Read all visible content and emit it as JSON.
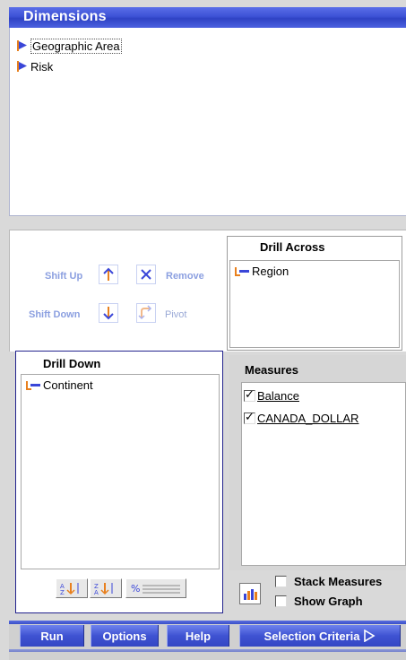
{
  "dimensions": {
    "title": "Dimensions",
    "items": [
      {
        "label": "Geographic Area",
        "icon": "dimension-flag-icon"
      },
      {
        "label": "Risk",
        "icon": "dimension-flag-icon"
      }
    ]
  },
  "toolbar": {
    "shift_up": "Shift Up",
    "remove": "Remove",
    "shift_down": "Shift Down",
    "pivot": "Pivot"
  },
  "drill_across": {
    "title": "Drill Across",
    "items": [
      {
        "label": "Region",
        "icon": "level-icon"
      }
    ]
  },
  "drill_down": {
    "title": "Drill Down",
    "items": [
      {
        "label": "Continent",
        "icon": "level-icon"
      }
    ],
    "sort_buttons": [
      "sort-ascending-icon",
      "sort-descending-icon",
      "percent-icon"
    ]
  },
  "measures": {
    "title": "Measures",
    "items": [
      {
        "label": "Balance",
        "checked": true
      },
      {
        "label": "CANADA_DOLLAR",
        "checked": true
      }
    ],
    "stack_measures": {
      "label": "Stack Measures",
      "checked": false
    },
    "show_graph": {
      "label": "Show Graph",
      "checked": false
    }
  },
  "bottom_bar": {
    "run": "Run",
    "options": "Options",
    "help": "Help",
    "selection_criteria": "Selection Criteria"
  },
  "colors": {
    "accent": "#3d52d6",
    "icon_orange": "#e8801e",
    "level_blue": "#3a46d8"
  }
}
